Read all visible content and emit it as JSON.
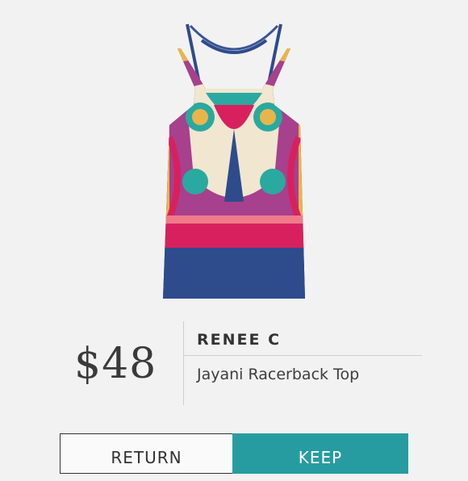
{
  "product": {
    "price": "$48",
    "brand": "RENEE C",
    "name": "Jayani Racerback Top"
  },
  "actions": {
    "return_label": "RETURN",
    "keep_label": "KEEP"
  },
  "colors": {
    "background": "#f2f2f2",
    "keep_button": "#279ca0",
    "top_navy": "#2e4b8c",
    "top_pink": "#d8205f",
    "top_magenta": "#a7408d",
    "top_yellow": "#e9b54a"
  }
}
